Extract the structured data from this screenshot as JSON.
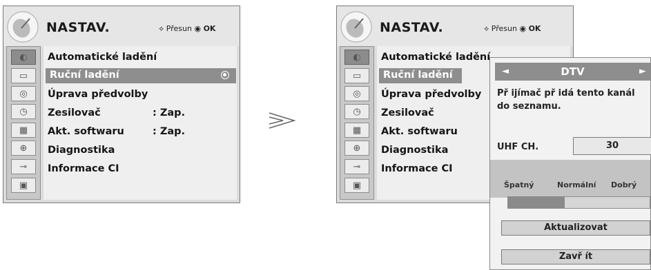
{
  "left_menu": {
    "title": "NASTAV.",
    "hint_move": "Přesun",
    "hint_ok": "OK",
    "items": [
      {
        "label": "Automatické ladění",
        "value": ""
      },
      {
        "label": "Ruční ladění",
        "value": ""
      },
      {
        "label": "Úprava předvolby",
        "value": ""
      },
      {
        "label": "Zesilovač",
        "value": ": Zap."
      },
      {
        "label": "Akt. softwaru",
        "value": ": Zap."
      },
      {
        "label": "Diagnostika",
        "value": ""
      },
      {
        "label": "Informace CI",
        "value": ""
      }
    ],
    "selected_index": 1,
    "icons": [
      "satellite-icon",
      "tv-screen-icon",
      "disc-icon",
      "clock-icon",
      "calendar-icon",
      "lock-icon",
      "usb-icon",
      "photo-icon"
    ]
  },
  "right_menu": {
    "title": "NASTAV.",
    "hint_move": "Přesun",
    "hint_ok": "OK",
    "items": [
      {
        "label": "Automatické ladění"
      },
      {
        "label": "Ruční ladění"
      },
      {
        "label": "Úprava předvolby"
      },
      {
        "label": "Zesilovač"
      },
      {
        "label": "Akt. softwaru"
      },
      {
        "label": "Diagnostika"
      },
      {
        "label": "Informace CI"
      }
    ],
    "selected_index": 1
  },
  "transition_arrow": "≫",
  "dtv_panel": {
    "left_arrow": "◄",
    "title": "DTV",
    "right_arrow": "►",
    "message": "Př ijímač př idá tento kanál do seznamu.",
    "channel_label": "UHF CH.",
    "channel_value": "30",
    "quality_labels": {
      "bad": "Špatný",
      "normal": "Normální",
      "good": "Dobrý"
    },
    "signal_level": 0.4,
    "update_button": "Aktualizovat",
    "close_button": "Zavř ít"
  },
  "colors": {
    "highlight": "#8e8e8e",
    "panel_bg": "#f2f2f2",
    "menu_bg": "#efefef"
  }
}
